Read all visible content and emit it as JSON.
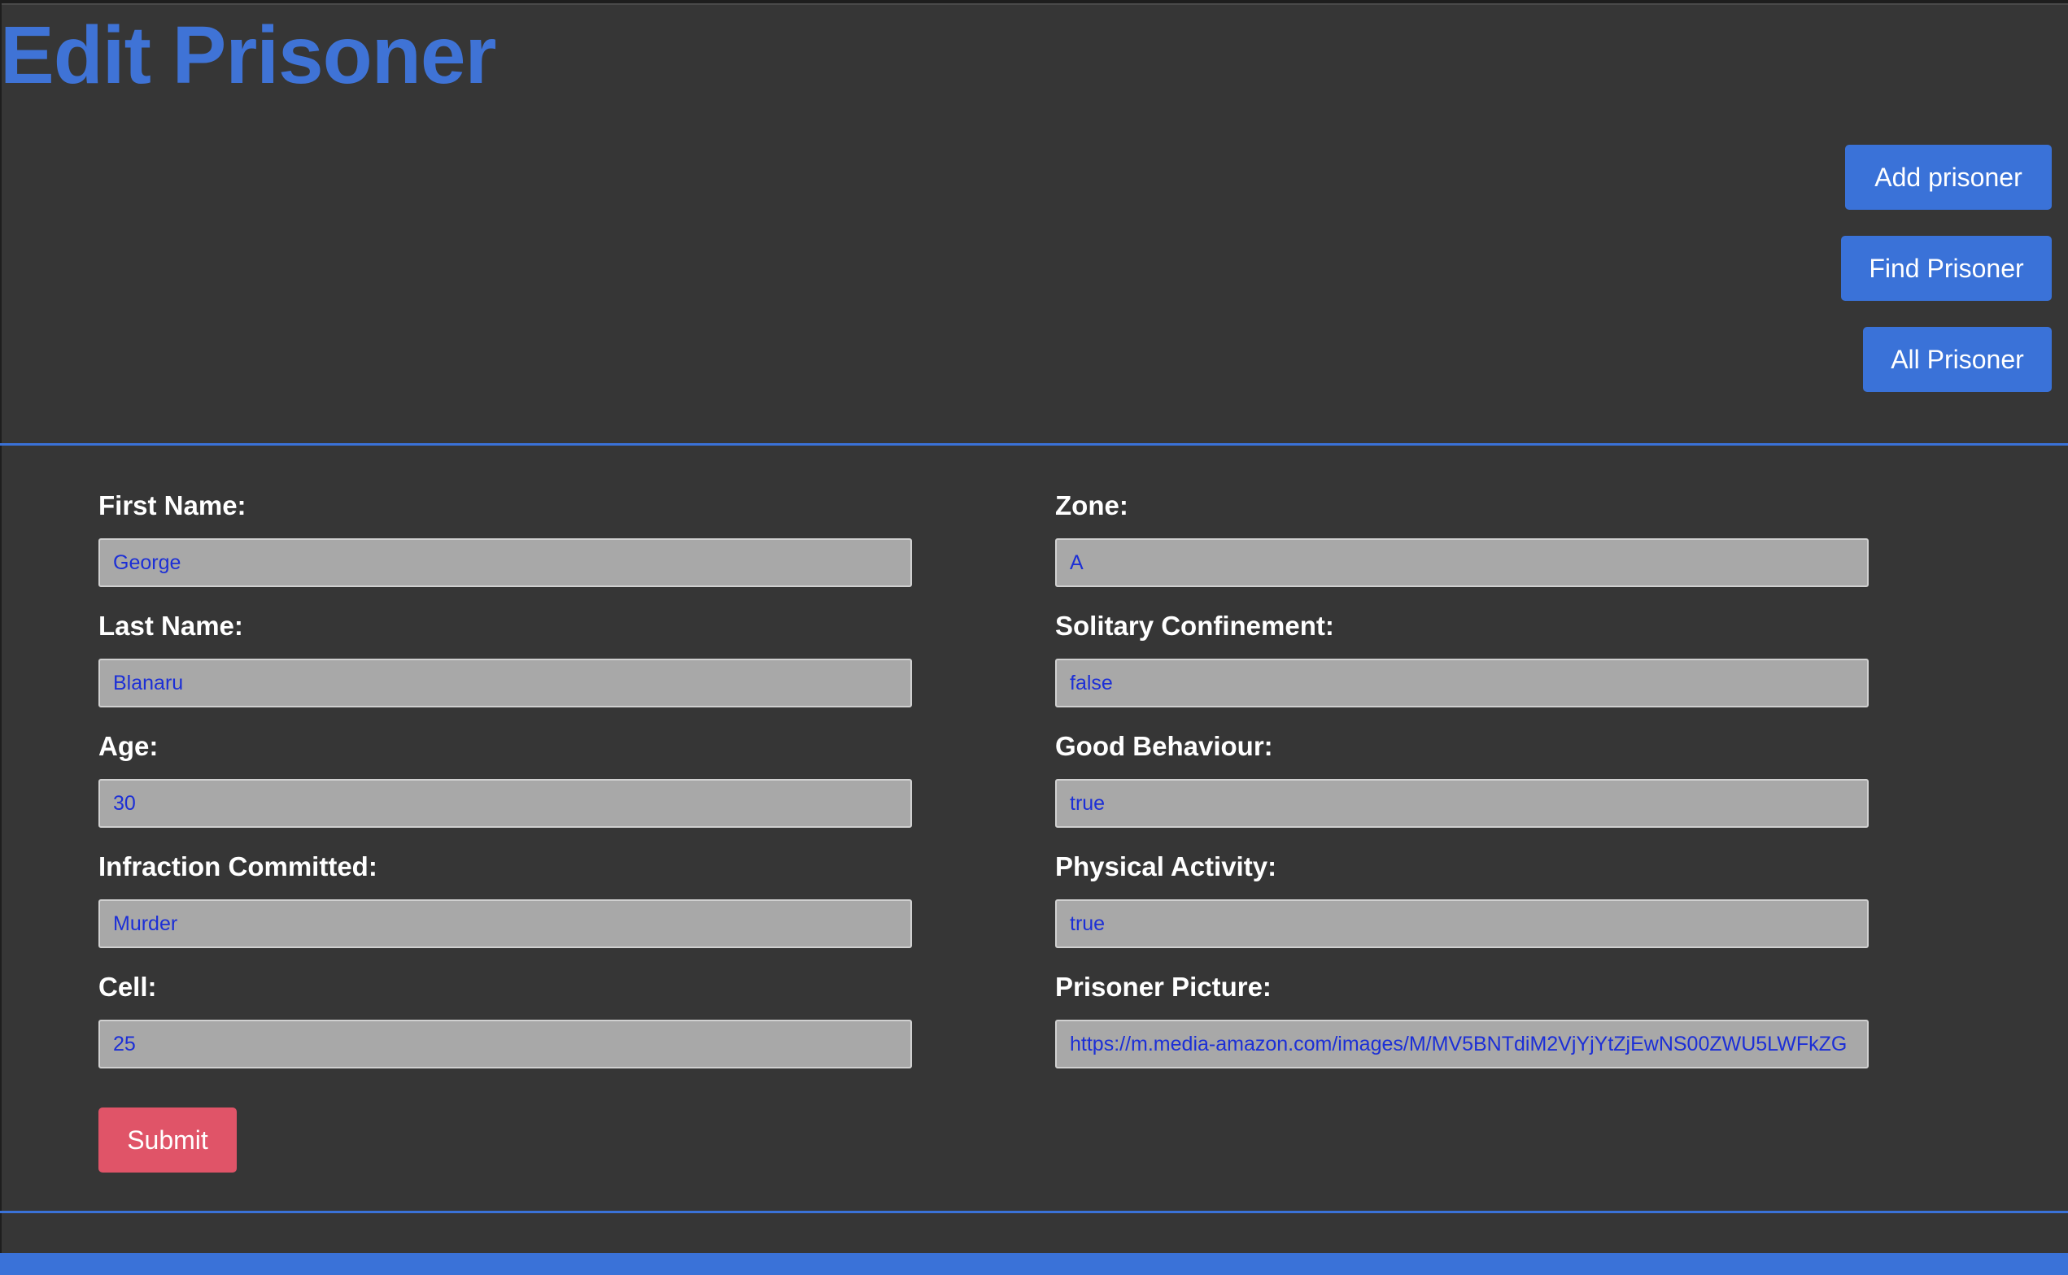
{
  "page": {
    "title": "Edit Prisoner"
  },
  "nav": {
    "add_label": "Add prisoner",
    "find_label": "Find Prisoner",
    "all_label": "All Prisoner"
  },
  "form": {
    "first_name": {
      "label": "First Name:",
      "value": "George"
    },
    "last_name": {
      "label": "Last Name:",
      "value": "Blanaru"
    },
    "age": {
      "label": "Age:",
      "value": "30"
    },
    "infraction": {
      "label": "Infraction Committed:",
      "value": "Murder"
    },
    "cell": {
      "label": "Cell:",
      "value": "25"
    },
    "zone": {
      "label": "Zone:",
      "value": "A"
    },
    "solitary": {
      "label": "Solitary Confinement:",
      "value": "false"
    },
    "good_behaviour": {
      "label": "Good Behaviour:",
      "value": "true"
    },
    "physical_activity": {
      "label": "Physical Activity:",
      "value": "true"
    },
    "picture": {
      "label": "Prisoner Picture:",
      "value": "https://m.media-amazon.com/images/M/MV5BNTdiM2VjYjYtZjEwNS00ZWU5LWFkZG"
    },
    "submit_label": "Submit"
  },
  "colors": {
    "background": "#363636",
    "accent": "#3a72d8",
    "title": "#3f73d6",
    "submit": "#e05468",
    "input_bg": "#a8a8a8",
    "input_text": "#1c2fd6"
  }
}
